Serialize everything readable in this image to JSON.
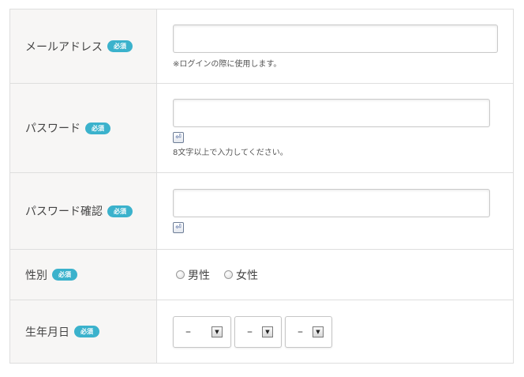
{
  "required_badge": "必須",
  "fields": {
    "email": {
      "label": "メールアドレス",
      "value": "",
      "hint": "※ログインの際に使用します。"
    },
    "password": {
      "label": "パスワード",
      "value": "",
      "show_icon": "⏎",
      "hint": "8文字以上で入力してください。"
    },
    "password_confirm": {
      "label": "パスワード確認",
      "value": "",
      "show_icon": "⏎"
    },
    "gender": {
      "label": "性別",
      "options": [
        "男性",
        "女性"
      ]
    },
    "birthdate": {
      "label": "生年月日",
      "year": "–",
      "month": "–",
      "day": "–",
      "arrow_glyph": "▼"
    }
  },
  "colors": {
    "badge": "#3bb2cc",
    "label_background": "#f7f6f5",
    "border": "#dedede"
  }
}
